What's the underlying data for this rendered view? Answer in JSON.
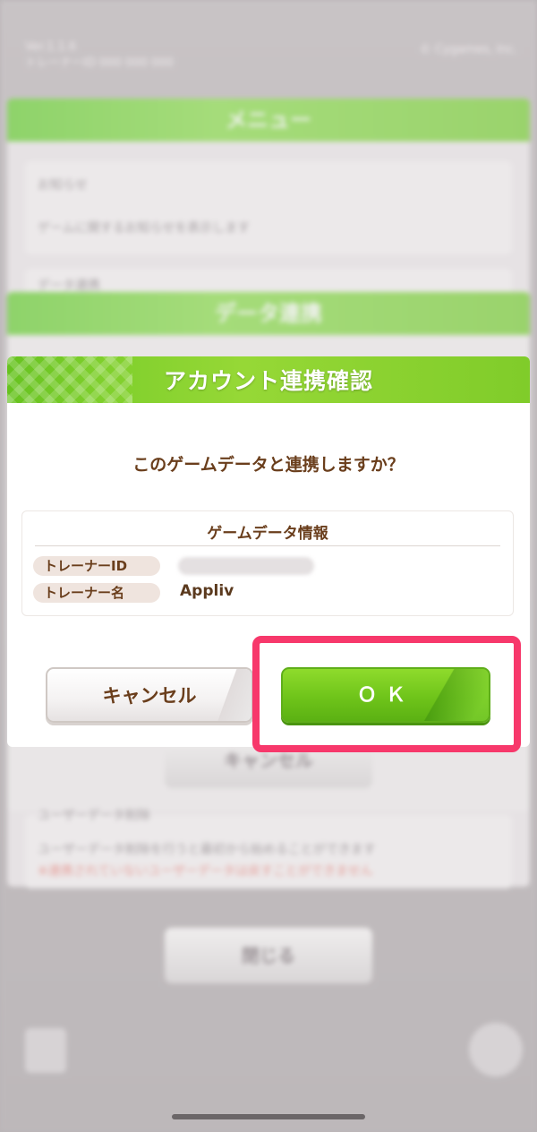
{
  "background": {
    "version_line": "Ver.1.1.6",
    "user_id_line": "トレーナーID 000 000 000",
    "copyright": "© Cygames, Inc.",
    "menu_title": "メニュー",
    "notice_title": "お知らせ",
    "notice_desc": "ゲームに関するお知らせを表示します",
    "data_transfer_title": "データ連携",
    "data_link_title": "データ連携",
    "cancel_label": "キャンセル",
    "delete_title": "ユーザーデータ削除",
    "delete_desc": "ユーザーデータ削除を行うと最初から始めることができます",
    "delete_warning": "※連携されていないユーザーデータは戻すことができません",
    "close_label": "閉じる"
  },
  "dialog": {
    "title": "アカウント連携確認",
    "question": "このゲームデータと連携しますか？",
    "info_title": "ゲームデータ情報",
    "trainer_id_label": "トレーナーID",
    "trainer_name_label": "トレーナー名",
    "trainer_name_value": "Appliv",
    "cancel_label": "キャンセル",
    "ok_label": "ＯＫ"
  },
  "colors": {
    "header_green": "#7fcf2c",
    "ok_green": "#6fc41a",
    "text_brown": "#6a3e1c",
    "highlight_pink": "#f7386b"
  }
}
